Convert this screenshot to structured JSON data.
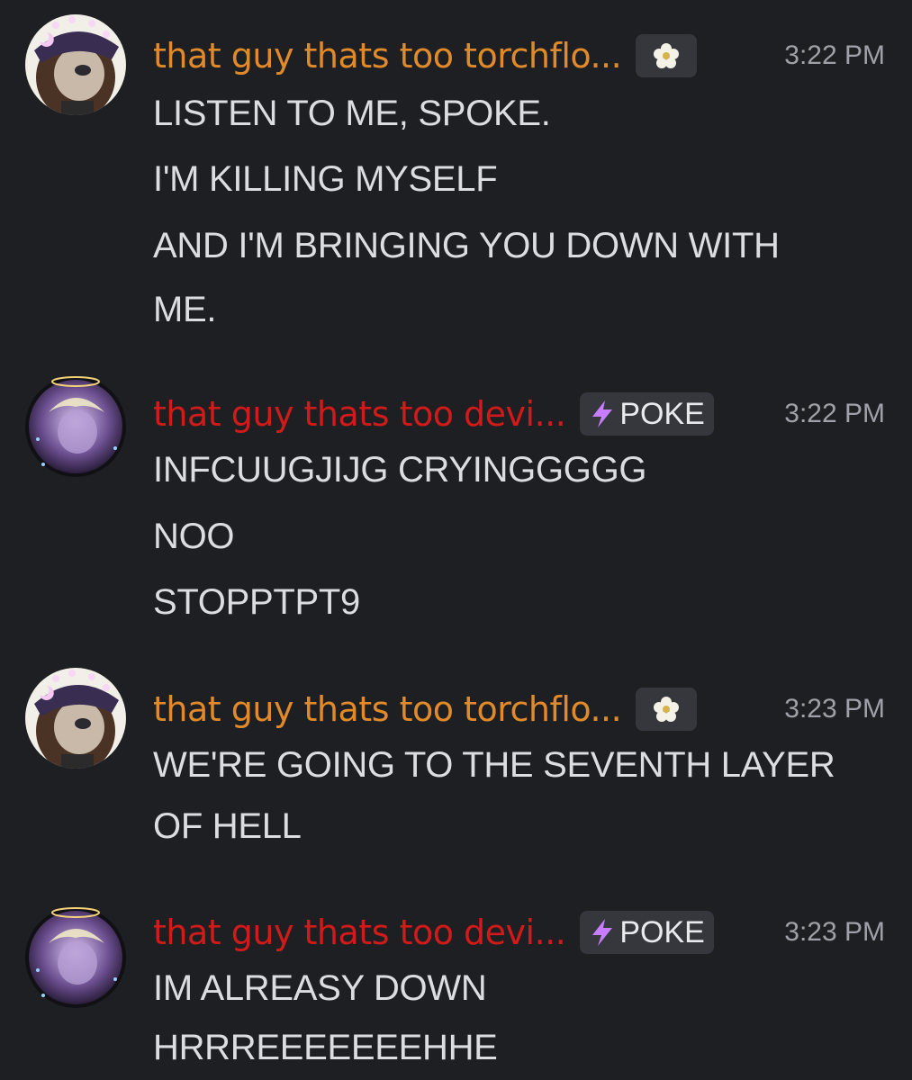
{
  "messages": [
    {
      "username": "that guy thats too torchflo...",
      "tag_icon": "flower-icon",
      "time": "3:22 PM",
      "lines": [
        "LISTEN TO ME, SPOKE.",
        "I'M KILLING MYSELF",
        "AND I'M BRINGING YOU DOWN WITH",
        "ME."
      ]
    },
    {
      "username": "that guy thats too devi...",
      "tag_icon": "lightning-icon",
      "tag_label": "POKE",
      "time": "3:22 PM",
      "lines": [
        "INFCUUGJIJG CRYINGGGGG",
        "NOO",
        "STOPPTPT9"
      ]
    },
    {
      "username": "that guy thats too torchflo...",
      "tag_icon": "flower-icon",
      "time": "3:23 PM",
      "lines": [
        "WE'RE GOING TO THE SEVENTH LAYER",
        "OF HELL"
      ]
    },
    {
      "username": "that guy thats too devi...",
      "tag_icon": "lightning-icon",
      "tag_label": "POKE",
      "time": "3:23 PM",
      "lines": [
        "IM ALREASY DOWN",
        "HRRREEEEEEEHHE"
      ]
    }
  ],
  "colors": {
    "background": "#1e1f23",
    "username_orange": "#e08a2a",
    "username_red": "#d11a1a",
    "message_text": "#dcdde1",
    "timestamp": "#9ea1a8",
    "tag_background": "#35373d",
    "lightning": "#c77dff"
  }
}
